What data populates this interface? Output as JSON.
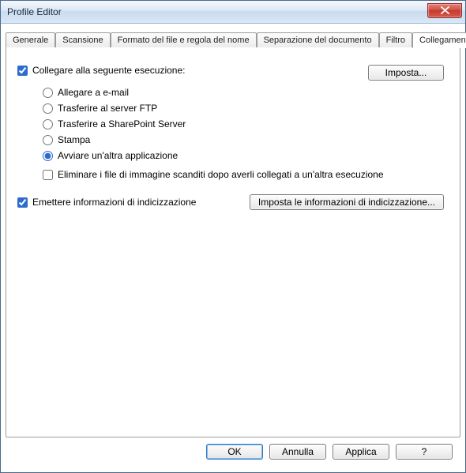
{
  "window": {
    "title": "Profile Editor"
  },
  "tabs": [
    {
      "label": "Generale"
    },
    {
      "label": "Scansione"
    },
    {
      "label": "Formato del file e regola del nome"
    },
    {
      "label": "Separazione del documento"
    },
    {
      "label": "Filtro"
    },
    {
      "label": "Collegamento"
    }
  ],
  "content": {
    "linkCheckboxLabel": "Collegare alla seguente esecuzione:",
    "linkChecked": true,
    "impostaButton": "Imposta...",
    "radios": {
      "attachEmail": "Allegare a e-mail",
      "ftp": "Trasferire al server FTP",
      "sharepoint": "Trasferire a SharePoint Server",
      "print": "Stampa",
      "launchApp": "Avviare un'altra applicazione",
      "selected": "launchApp"
    },
    "deleteCheckboxLabel": "Eliminare i file di immagine scanditi dopo averli collegati a un'altra esecuzione",
    "deleteChecked": false,
    "emitIndexLabel": "Emettere informazioni di indicizzazione",
    "emitIndexChecked": true,
    "emitIndexButton": "Imposta le informazioni di indicizzazione..."
  },
  "footer": {
    "ok": "OK",
    "cancel": "Annulla",
    "apply": "Applica",
    "help": "?"
  }
}
